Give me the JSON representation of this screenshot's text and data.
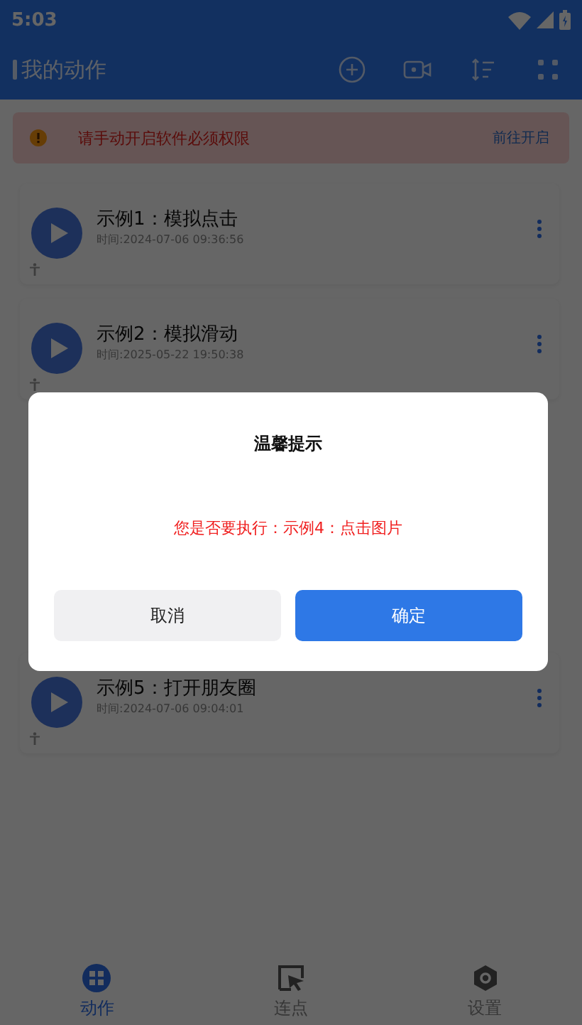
{
  "status_bar": {
    "time": "5:03"
  },
  "header": {
    "title": "我的动作"
  },
  "banner": {
    "message": "请手动开启软件必须权限",
    "action": "前往开启"
  },
  "actions": [
    {
      "title": "示例1：模拟点击",
      "time": "时间:2024-07-06 09:36:56"
    },
    {
      "title": "示例2：模拟滑动",
      "time": "时间:2025-05-22 19:50:38"
    },
    {
      "title": "示例5：打开朋友圈",
      "time": "时间:2024-07-06 09:04:01"
    }
  ],
  "dialog": {
    "title": "温馨提示",
    "message": "您是否要执行：示例4：点击图片",
    "buttons": [
      {
        "label": "取消",
        "kind": "secondary"
      },
      {
        "label": "确定",
        "kind": "primary"
      }
    ]
  },
  "nav": [
    {
      "label": "动作",
      "selected": true
    },
    {
      "label": "连点",
      "selected": false
    },
    {
      "label": "设置",
      "selected": false
    }
  ]
}
